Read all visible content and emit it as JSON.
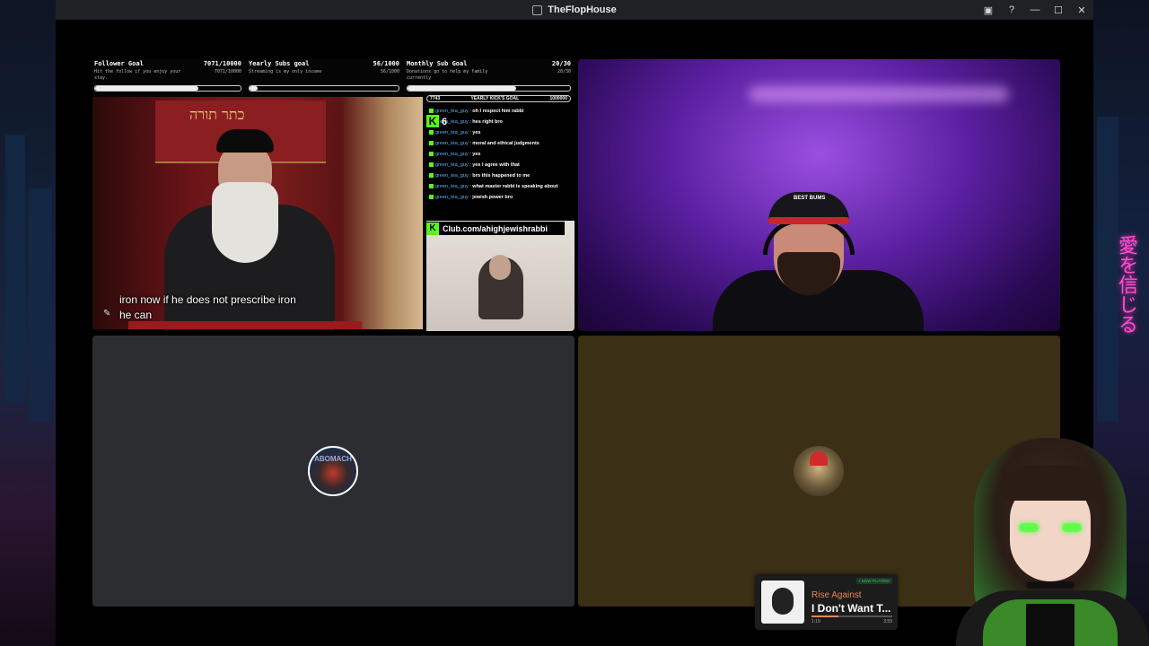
{
  "window": {
    "title": "TheFlopHouse"
  },
  "titlebar_icons": [
    "inbox-icon",
    "help-icon",
    "minimize-icon",
    "maximize-icon",
    "close-icon"
  ],
  "goals": [
    {
      "title": "Follower Goal",
      "value": "7071/10000",
      "subtitle": "Hit the follow if you enjoy your stay.",
      "value2": "7071/10000",
      "progress": 0.7071
    },
    {
      "title": "Yearly Subs goal",
      "value": "56/1000",
      "subtitle": "Streaming is my only income",
      "value2": "56/1000",
      "progress": 0.056
    },
    {
      "title": "Monthly Sub Goal",
      "value": "20/30",
      "subtitle": "Donations go to help my family currently",
      "value2": "20/30",
      "progress": 0.667
    }
  ],
  "stream": {
    "ark_text": "כתר תורה",
    "caption_line1": "iron now if he does not prescribe iron",
    "caption_line2": "he can"
  },
  "kick_goal": {
    "left": "7743",
    "label": "YEARLY KICK'S GOAL",
    "right": "1000000"
  },
  "kick_counter": {
    "badge": "K",
    "count": "6"
  },
  "chat": [
    {
      "user": "green_tea_guy",
      "msg": "oh I respect him rabbi"
    },
    {
      "user": "green_tea_guy",
      "msg": "hes right bro"
    },
    {
      "user": "green_tea_guy",
      "msg": "yes"
    },
    {
      "user": "green_tea_guy",
      "msg": "moral and ethical judgments"
    },
    {
      "user": "green_tea_guy",
      "msg": "yes"
    },
    {
      "user": "green_tea_guy",
      "msg": "yes I agree with that"
    },
    {
      "user": "green_tea_guy",
      "msg": "bro this happened to me"
    },
    {
      "user": "green_tea_guy",
      "msg": "what master rabbi is speaking about"
    },
    {
      "user": "green_tea_guy",
      "msg": "jewish power bro"
    }
  ],
  "club_banner": {
    "badge": "K",
    "text": "Club.com/ahighjewishrabbi"
  },
  "webcam": {
    "cap_text": "BEST BUMS"
  },
  "participants": [
    {
      "avatar_label": "ABOMACH",
      "bg": "#2b2d31"
    },
    {
      "avatar_label": "",
      "bg": "#3b2f15"
    }
  ],
  "now_playing": {
    "badge": "• NOW PLAYING",
    "artist": "Rise Against",
    "title": "I Don't Want T...",
    "elapsed": "1:19",
    "duration": "3:59",
    "progress": 0.33,
    "accent": "#e6875a"
  },
  "neon_sign": "愛を信じる"
}
